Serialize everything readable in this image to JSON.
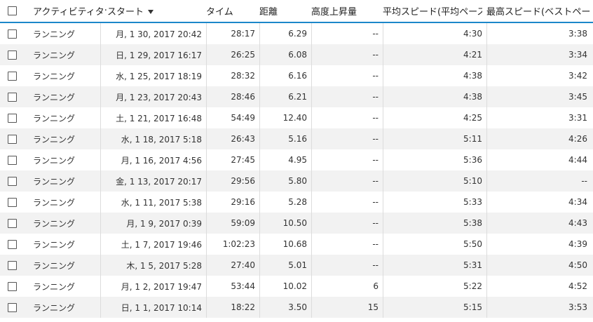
{
  "columns": {
    "activity_type": "アクティビティタ",
    "start": "スタート",
    "time": "タイム",
    "distance": "距離",
    "elevation": "高度上昇量",
    "avg_speed": "平均スピード(平均ペース",
    "max_speed": "最高スピード(ベストペー"
  },
  "sort_indicator": "chevron-down-icon",
  "rows": [
    {
      "type": "ランニング",
      "start": "月, 1 30, 2017 20:42",
      "time": "28:17",
      "distance": "6.29",
      "elevation": "--",
      "avg": "4:30",
      "max": "3:38"
    },
    {
      "type": "ランニング",
      "start": "日, 1 29, 2017 16:17",
      "time": "26:25",
      "distance": "6.08",
      "elevation": "--",
      "avg": "4:21",
      "max": "3:34"
    },
    {
      "type": "ランニング",
      "start": "水, 1 25, 2017 18:19",
      "time": "28:32",
      "distance": "6.16",
      "elevation": "--",
      "avg": "4:38",
      "max": "3:42"
    },
    {
      "type": "ランニング",
      "start": "月, 1 23, 2017 20:43",
      "time": "28:46",
      "distance": "6.21",
      "elevation": "--",
      "avg": "4:38",
      "max": "3:45"
    },
    {
      "type": "ランニング",
      "start": "土, 1 21, 2017 16:48",
      "time": "54:49",
      "distance": "12.40",
      "elevation": "--",
      "avg": "4:25",
      "max": "3:31"
    },
    {
      "type": "ランニング",
      "start": "水, 1 18, 2017 5:18",
      "time": "26:43",
      "distance": "5.16",
      "elevation": "--",
      "avg": "5:11",
      "max": "4:26"
    },
    {
      "type": "ランニング",
      "start": "月, 1 16, 2017 4:56",
      "time": "27:45",
      "distance": "4.95",
      "elevation": "--",
      "avg": "5:36",
      "max": "4:44"
    },
    {
      "type": "ランニング",
      "start": "金, 1 13, 2017 20:17",
      "time": "29:56",
      "distance": "5.80",
      "elevation": "--",
      "avg": "5:10",
      "max": "--"
    },
    {
      "type": "ランニング",
      "start": "水, 1 11, 2017 5:38",
      "time": "29:16",
      "distance": "5.28",
      "elevation": "--",
      "avg": "5:33",
      "max": "4:34"
    },
    {
      "type": "ランニング",
      "start": "月, 1 9, 2017 0:39",
      "time": "59:09",
      "distance": "10.50",
      "elevation": "--",
      "avg": "5:38",
      "max": "4:43"
    },
    {
      "type": "ランニング",
      "start": "土, 1 7, 2017 19:46",
      "time": "1:02:23",
      "distance": "10.68",
      "elevation": "--",
      "avg": "5:50",
      "max": "4:39"
    },
    {
      "type": "ランニング",
      "start": "木, 1 5, 2017 5:28",
      "time": "27:40",
      "distance": "5.01",
      "elevation": "--",
      "avg": "5:31",
      "max": "4:50"
    },
    {
      "type": "ランニング",
      "start": "月, 1 2, 2017 19:47",
      "time": "53:44",
      "distance": "10.02",
      "elevation": "6",
      "avg": "5:22",
      "max": "4:52"
    },
    {
      "type": "ランニング",
      "start": "日, 1 1, 2017 10:14",
      "time": "18:22",
      "distance": "3.50",
      "elevation": "15",
      "avg": "5:15",
      "max": "3:53"
    }
  ]
}
